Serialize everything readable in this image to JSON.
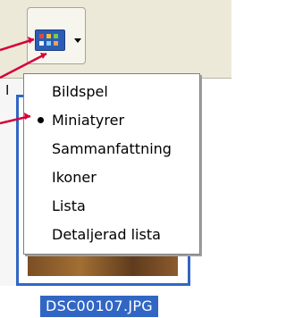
{
  "toolbar": {
    "view_button_icon": "thumbnail-grid-icon",
    "view_button_arrow_icon": "chevron-down-icon"
  },
  "left_sliver": {
    "cut_letter": "I"
  },
  "thumbnail": {
    "filename": "DSC00107.JPG"
  },
  "menu": {
    "items": [
      {
        "label": "Bildspel",
        "selected": false
      },
      {
        "label": "Miniatyrer",
        "selected": true
      },
      {
        "label": "Sammanfattning",
        "selected": false
      },
      {
        "label": "Ikoner",
        "selected": false
      },
      {
        "label": "Lista",
        "selected": false
      },
      {
        "label": "Detaljerad lista",
        "selected": false
      }
    ]
  },
  "colors": {
    "accent": "#3166c4",
    "callout": "#d6003a"
  }
}
